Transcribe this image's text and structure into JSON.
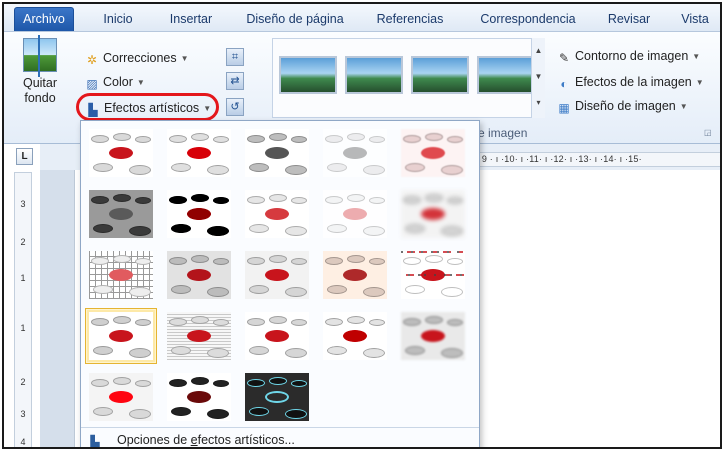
{
  "tabs": [
    "Archivo",
    "Inicio",
    "Insertar",
    "Diseño de página",
    "Referencias",
    "Correspondencia",
    "Revisar",
    "Vista"
  ],
  "ribbon": {
    "remove_bg": "Quitar fondo",
    "corrections": "Correcciones",
    "color": "Color",
    "artistic_effects": "Efectos artísticos",
    "styles_group_label_visible": "e imagen",
    "picture_border": "Contorno de imagen",
    "picture_effects": "Efectos de la imagen",
    "picture_layout": "Diseño de imagen"
  },
  "ruler": {
    "horizontal": "· 9 · ı ·10· ı ·11· ı ·12· ı ·13· ı ·14· ı ·15·",
    "vertical": [
      "3",
      "2",
      "1",
      "1",
      "2",
      "3",
      "4"
    ]
  },
  "gallery": {
    "effects": [
      {
        "name": "Ninguno",
        "row": 1,
        "col": 1
      },
      {
        "name": "Marcador",
        "row": 1,
        "col": 2
      },
      {
        "name": "Boceto a lápiz",
        "row": 1,
        "col": 3
      },
      {
        "name": "Dibujo lineal",
        "row": 1,
        "col": 4
      },
      {
        "name": "Tiza",
        "row": 1,
        "col": 5
      },
      {
        "name": "Pintar trazos",
        "row": 2,
        "col": 1
      },
      {
        "name": "Boceto a pincel",
        "row": 2,
        "col": 2
      },
      {
        "name": "Esponja de acuarela",
        "row": 2,
        "col": 3
      },
      {
        "name": "Textura de película",
        "row": 2,
        "col": 4
      },
      {
        "name": "Desenfoque",
        "row": 2,
        "col": 5
      },
      {
        "name": "Cristal",
        "row": 3,
        "col": 1
      },
      {
        "name": "Esbozo",
        "row": 3,
        "col": 2
      },
      {
        "name": "Pasteles suaves",
        "row": 3,
        "col": 3
      },
      {
        "name": "Emborronado",
        "row": 3,
        "col": 4
      },
      {
        "name": "Fotocopia",
        "row": 3,
        "col": 5
      },
      {
        "name": "Mosaico de burbujas",
        "row": 4,
        "col": 1,
        "selected": true
      },
      {
        "name": "Trama",
        "row": 4,
        "col": 2
      },
      {
        "name": "Suavizado",
        "row": 4,
        "col": 3
      },
      {
        "name": "Cemento",
        "row": 4,
        "col": 4
      },
      {
        "name": "Fundido",
        "row": 4,
        "col": 5
      },
      {
        "name": "Pintura plástica",
        "row": 5,
        "col": 1
      },
      {
        "name": "Sombra",
        "row": 5,
        "col": 2
      },
      {
        "name": "Bordes resplandecientes",
        "row": 5,
        "col": 3
      }
    ],
    "options_label_before": "Opciones de ",
    "options_label_mnemonic": "e",
    "options_label_after": "fectos artísticos..."
  },
  "colors": {
    "file_tab": "#2a63b4",
    "highlight_ring": "#e4161b",
    "selection": "#fde9a8",
    "disc_red": "#c8141c"
  },
  "icons": [
    "sun-icon",
    "color-palette-icon",
    "artistic-brush-icon",
    "compress-icon",
    "change-picture-icon",
    "reset-picture-icon",
    "pencil-border-icon",
    "effects-icon",
    "layout-icon",
    "dialog-launcher-icon"
  ]
}
